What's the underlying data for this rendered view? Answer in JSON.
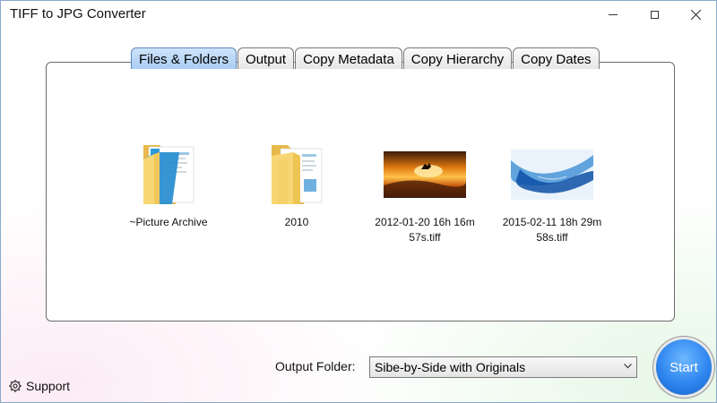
{
  "window": {
    "title": "TIFF to JPG Converter"
  },
  "tabs": [
    {
      "label": "Files & Folders",
      "active": true
    },
    {
      "label": "Output",
      "active": false
    },
    {
      "label": "Copy Metadata",
      "active": false
    },
    {
      "label": "Copy Hierarchy",
      "active": false
    },
    {
      "label": "Copy Dates",
      "active": false
    }
  ],
  "files": [
    {
      "name": "~Picture Archive",
      "icon": "folder-icon"
    },
    {
      "name": "2010",
      "icon": "folder-icon"
    },
    {
      "name": "2012-01-20 16h 16m 57s.tiff",
      "icon": "image-thumbnail"
    },
    {
      "name": "2015-02-11 18h 29m 58s.tiff",
      "icon": "image-thumbnail"
    }
  ],
  "footer": {
    "support_label": "Support",
    "output_folder_label": "Output Folder:",
    "output_folder_value": "Sibe-by-Side with Originals",
    "start_label": "Start"
  },
  "colors": {
    "accent_blue": "#2e86ef",
    "active_tab": "#a9cdf3",
    "folder_yellow": "#f5d36b"
  }
}
